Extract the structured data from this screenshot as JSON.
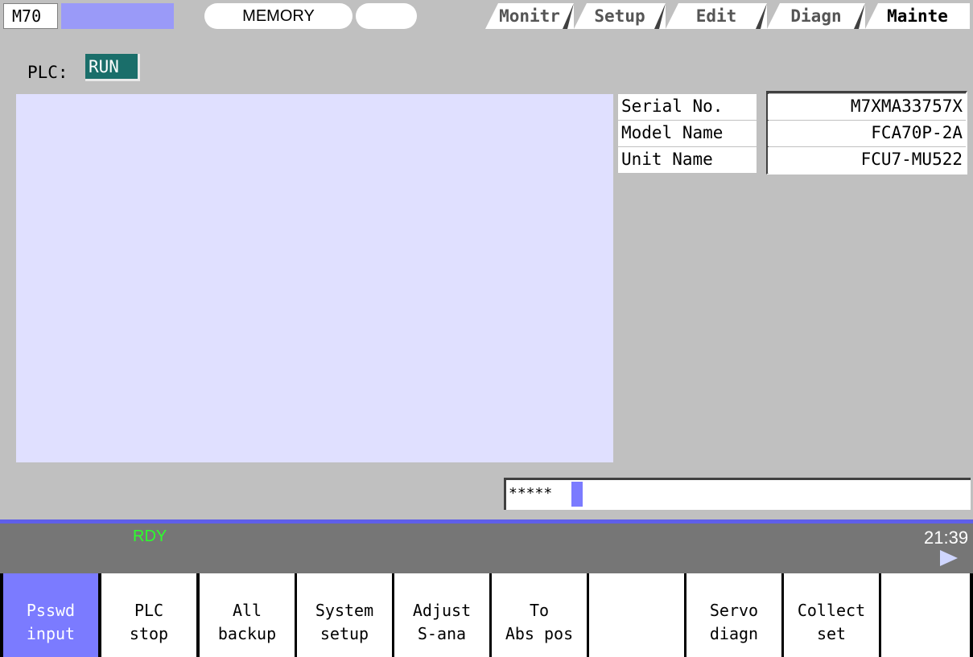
{
  "header": {
    "model": "M70",
    "mode": "MEMORY",
    "tabs": [
      {
        "label": "Monitr",
        "active": false
      },
      {
        "label": "Setup",
        "active": false
      },
      {
        "label": "Edit",
        "active": false
      },
      {
        "label": "Diagn",
        "active": false
      },
      {
        "label": "Mainte",
        "active": true
      }
    ]
  },
  "plc": {
    "label": "PLC:",
    "state": "RUN"
  },
  "info": [
    {
      "label": "Serial No.",
      "value": "M7XMA33757X"
    },
    {
      "label": "Model Name",
      "value": "FCA70P-2A"
    },
    {
      "label": "Unit Name",
      "value": "FCU7-MU522"
    }
  ],
  "input": {
    "value": "*****"
  },
  "status": {
    "state": "RDY",
    "time": "21:39"
  },
  "function_keys": [
    {
      "line1": "Psswd",
      "line2": "input",
      "selected": true
    },
    {
      "line1": "PLC",
      "line2": "stop",
      "selected": false
    },
    {
      "line1": "All",
      "line2": "backup",
      "selected": false
    },
    {
      "line1": "System",
      "line2": "setup",
      "selected": false
    },
    {
      "line1": "Adjust",
      "line2": "S-ana",
      "selected": false
    },
    {
      "line1": "To",
      "line2": "Abs pos",
      "selected": false
    },
    {
      "line1": "",
      "line2": "",
      "selected": false
    },
    {
      "line1": "Servo",
      "line2": "diagn",
      "selected": false
    },
    {
      "line1": "Collect",
      "line2": "set",
      "selected": false
    },
    {
      "line1": "",
      "line2": "",
      "selected": false
    }
  ],
  "colors": {
    "accent": "#7b7bff",
    "plc_state_bg": "#1a6e6a",
    "panel_bg": "#e0e0ff",
    "status_ok": "#2cff2c"
  }
}
